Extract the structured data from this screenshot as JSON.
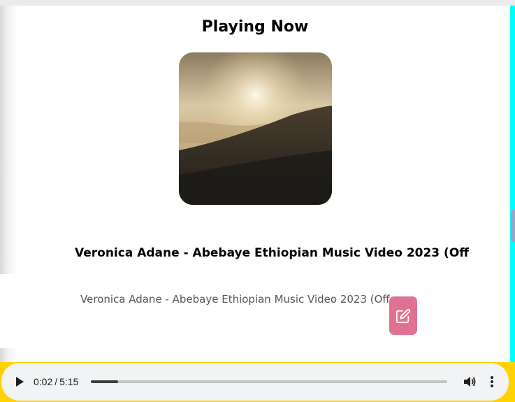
{
  "page": {
    "heading": "Playing Now"
  },
  "song": {
    "title": "Veronica Adane - Abebaye Ethiopian Music Video 2023 (Off",
    "description": "Veronica Adane - Abebaye Ethiopian Music Video 2023 (Off",
    "cover_icon": "misty-mountain-landscape"
  },
  "edit_button": {
    "icon": "edit-icon",
    "color": "#e07193"
  },
  "player": {
    "current_time": "0:02",
    "separator": "/",
    "duration": "5:15",
    "progress_fraction": 0.0762,
    "play_icon": "play-icon",
    "volume_icon": "volume-icon",
    "menu_icon": "more-vertical-icon"
  },
  "colors": {
    "right_border": "#00ffff",
    "bottom_border": "#ffd200",
    "player_background": "#f1f3f4"
  }
}
